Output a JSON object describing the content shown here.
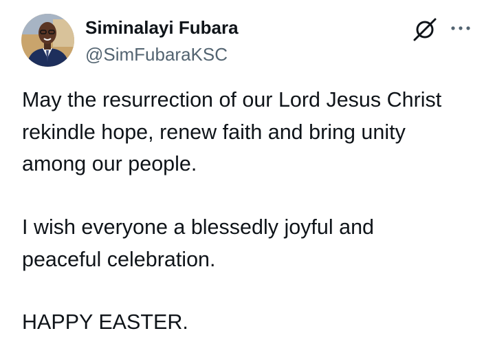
{
  "author": {
    "display_name": "Siminalayi Fubara",
    "handle": "@SimFubaraKSC",
    "avatar_icon": "profile-photo"
  },
  "actions": {
    "grok_icon": "grok-icon",
    "more_icon": "more-options-icon"
  },
  "tweet": {
    "paragraph1": [
      "May the resurrection of our Lord Jesus Christ",
      "rekindle hope, renew faith and bring unity",
      "among our people."
    ],
    "paragraph2": [
      "I wish everyone a blessedly joyful and",
      "peaceful celebration."
    ],
    "paragraph3": [
      "HAPPY EASTER."
    ]
  },
  "colors": {
    "text_primary": "#0f1419",
    "text_secondary": "#536471",
    "background": "#ffffff"
  }
}
